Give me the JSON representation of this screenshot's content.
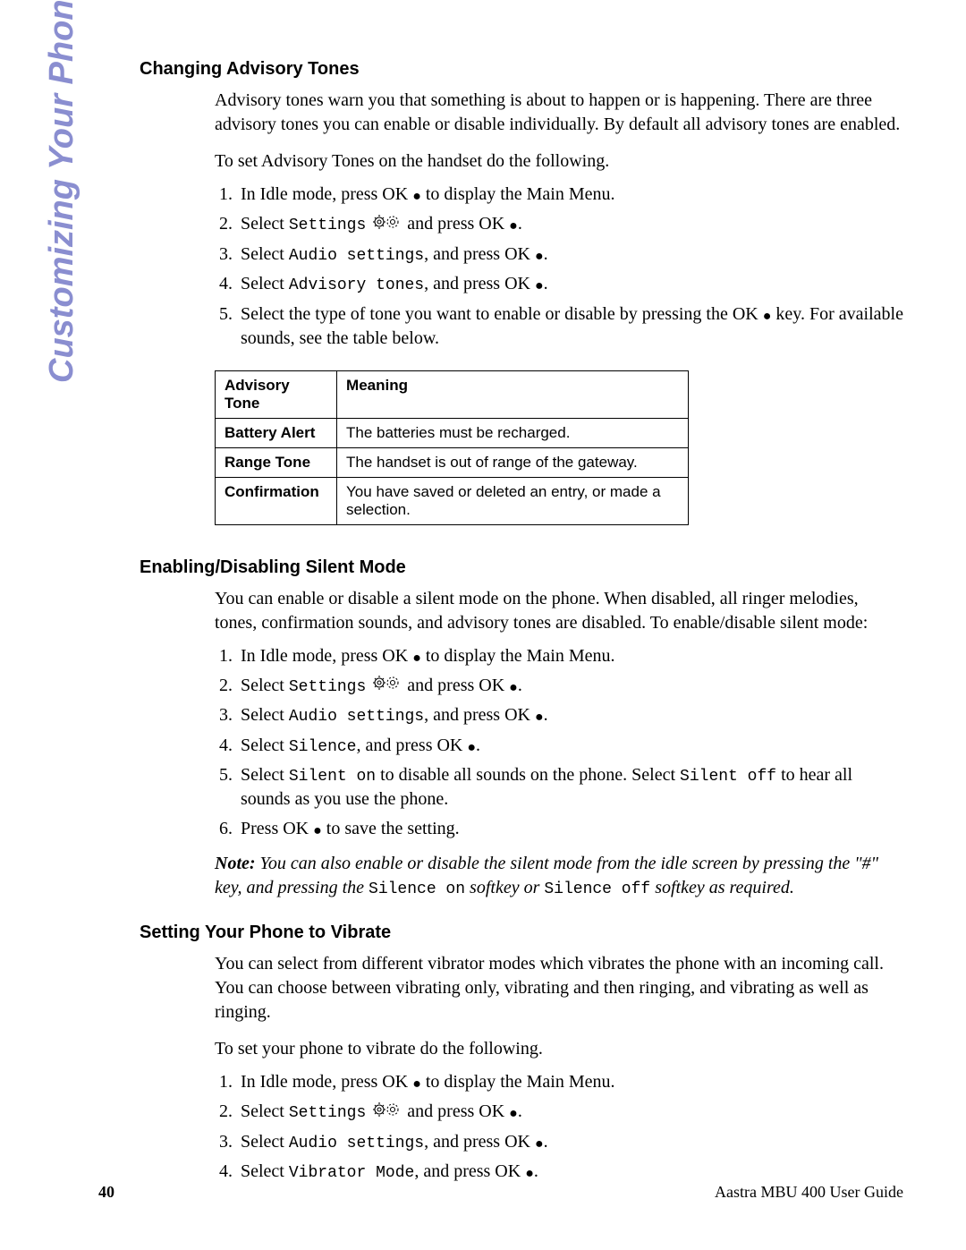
{
  "side_heading": "Customizing Your Phone",
  "sections": {
    "advisory": {
      "title": "Changing Advisory Tones",
      "intro1": "Advisory tones warn you that something is about to happen or is happening. There are three advisory tones you can enable or disable individually. By default all advisory tones are enabled.",
      "intro2": "To set Advisory Tones on the handset do the following.",
      "steps": {
        "s1a": "In Idle mode, press OK ",
        "s1b": " to display the Main Menu.",
        "s2a": "Select ",
        "s2b": "Settings",
        "s2c": " and press OK ",
        "s2d": ".",
        "s3a": "Select ",
        "s3b": "Audio settings",
        "s3c": ", and press OK ",
        "s3d": ".",
        "s4a": "Select ",
        "s4b": "Advisory tones",
        "s4c": ", and press OK ",
        "s4d": ".",
        "s5a": "Select the type of tone you want to enable or disable by pressing the OK ",
        "s5b": " key. For available sounds, see the table below."
      },
      "table": {
        "h1": "Advisory Tone",
        "h2": "Meaning",
        "r1c1": "Battery Alert",
        "r1c2": "The batteries must be recharged.",
        "r2c1": "Range Tone",
        "r2c2": "The handset is out of range of the gateway.",
        "r3c1": "Confirmation",
        "r3c2": "You have saved or deleted an entry, or made a selection."
      }
    },
    "silent": {
      "title": "Enabling/Disabling Silent Mode",
      "intro1": "You can enable or disable a silent mode on the phone. When disabled, all ringer melodies, tones, confirmation sounds, and advisory tones are disabled. To enable/disable silent mode:",
      "steps": {
        "s1a": "In Idle mode, press OK ",
        "s1b": " to display the Main Menu.",
        "s2a": "Select ",
        "s2b": "Settings",
        "s2c": " and press OK ",
        "s2d": ".",
        "s3a": "Select ",
        "s3b": "Audio settings",
        "s3c": ", and press OK ",
        "s3d": ".",
        "s4a": "Select ",
        "s4b": "Silence",
        "s4c": ", and press OK ",
        "s4d": ".",
        "s5a": "Select ",
        "s5b": "Silent on",
        "s5c": " to disable all sounds on the phone. Select ",
        "s5d": "Silent off",
        "s5e": " to hear all sounds as you use the phone.",
        "s6a": "Press OK ",
        "s6b": " to save the setting."
      },
      "note": {
        "label": "Note:",
        "part1": " You can also enable or disable the silent mode from the idle screen by pressing the \"#\" key, and pressing the ",
        "mono1": "Silence on",
        "part2": " softkey or ",
        "mono2": "Silence off",
        "part3": " softkey as required."
      }
    },
    "vibrate": {
      "title": "Setting Your Phone to Vibrate",
      "intro1": "You can select from different vibrator modes which vibrates the phone with an incoming call. You can choose between vibrating only, vibrating and then ringing, and vibrating as well as ringing.",
      "intro2": "To set your phone to vibrate do the following.",
      "steps": {
        "s1a": "In Idle mode, press OK ",
        "s1b": " to display the Main Menu.",
        "s2a": "Select ",
        "s2b": "Settings",
        "s2c": " and press OK ",
        "s2d": ".",
        "s3a": "Select ",
        "s3b": "Audio settings",
        "s3c": ", and press OK ",
        "s3d": ".",
        "s4a": "Select ",
        "s4b": "Vibrator Mode",
        "s4c": ", and press OK ",
        "s4d": "."
      }
    }
  },
  "footer": {
    "page": "40",
    "guide": "Aastra MBU 400 User Guide"
  }
}
